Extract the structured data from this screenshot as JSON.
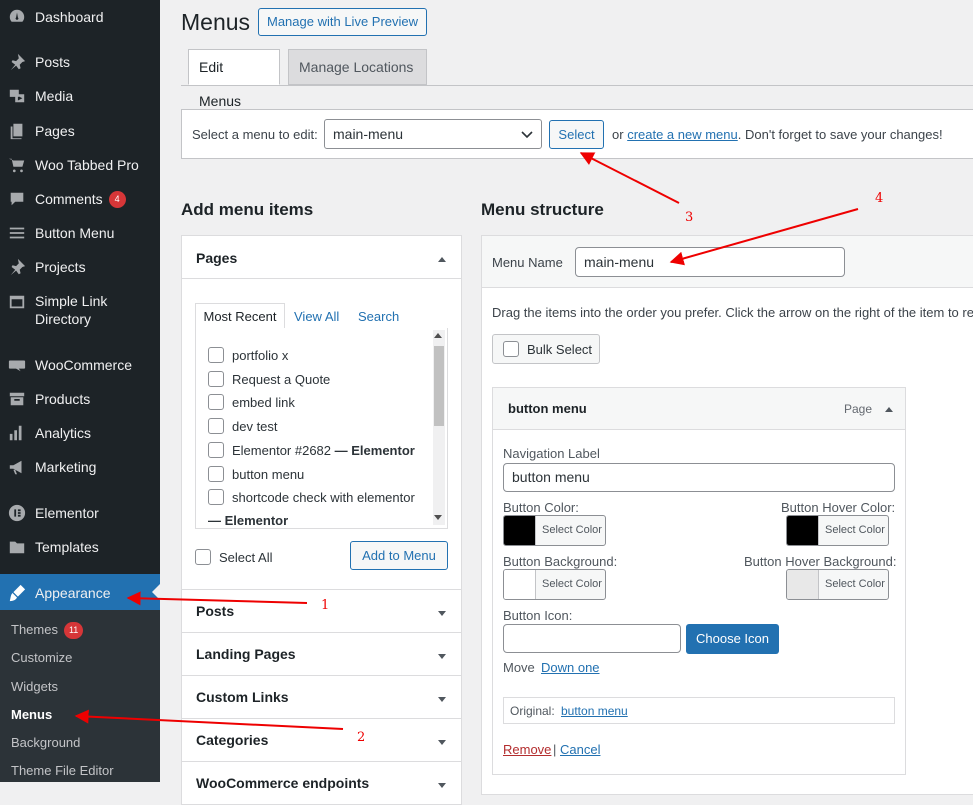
{
  "sidebar": {
    "items": [
      {
        "label": "Dashboard",
        "icon": "dashboard-icon"
      },
      {
        "label": "Posts",
        "icon": "pin-icon"
      },
      {
        "label": "Media",
        "icon": "media-icon"
      },
      {
        "label": "Pages",
        "icon": "pages-icon"
      },
      {
        "label": "Woo Tabbed Pro",
        "icon": "cart-icon"
      },
      {
        "label": "Comments",
        "icon": "comment-icon",
        "badge": "4"
      },
      {
        "label": "Button Menu",
        "icon": "menu-icon"
      },
      {
        "label": "Projects",
        "icon": "pin-icon"
      },
      {
        "label": "Simple Link",
        "label2": "Directory",
        "icon": "window-icon"
      },
      {
        "label": "WooCommerce",
        "icon": "woo-icon"
      },
      {
        "label": "Products",
        "icon": "archive-icon"
      },
      {
        "label": "Analytics",
        "icon": "bar-chart-icon"
      },
      {
        "label": "Marketing",
        "icon": "megaphone-icon"
      },
      {
        "label": "Elementor",
        "icon": "elementor-icon"
      },
      {
        "label": "Templates",
        "icon": "folder-icon"
      }
    ],
    "appearance": {
      "label": "Appearance",
      "icon": "brush-icon"
    },
    "submenu": [
      {
        "label": "Themes",
        "badge": "11"
      },
      {
        "label": "Customize"
      },
      {
        "label": "Widgets"
      },
      {
        "label": "Menus"
      },
      {
        "label": "Background"
      },
      {
        "label": "Theme File Editor"
      }
    ]
  },
  "header": {
    "title": "Menus",
    "live_preview": "Manage with Live Preview",
    "tabs": [
      "Edit Menus",
      "Manage Locations"
    ]
  },
  "select_bar": {
    "label": "Select a menu to edit:",
    "value": "main-menu",
    "button": "Select",
    "or": "or",
    "create_link": "create a new menu",
    "after": ". Don't forget to save your changes!"
  },
  "add_items": {
    "title": "Add menu items",
    "pages": {
      "title": "Pages",
      "tabs": [
        "Most Recent",
        "View All",
        "Search"
      ],
      "items": [
        "portfolio x",
        "Request a Quote",
        "embed link",
        "dev test",
        "Elementor #2682",
        "button menu",
        "shortcode check with elementor"
      ],
      "elementor_suffix": "— Elementor",
      "overflow_line": "— Elementor",
      "select_all": "Select All",
      "add_button": "Add to Menu"
    },
    "sections": [
      "Posts",
      "Landing Pages",
      "Custom Links",
      "Categories",
      "WooCommerce endpoints"
    ]
  },
  "structure": {
    "title": "Menu structure",
    "name_label": "Menu Name",
    "name_value": "main-menu",
    "hint": "Drag the items into the order you prefer. Click the arrow on the right of the item to reveal additional configuration options.",
    "bulk_select": "Bulk Select",
    "item": {
      "title": "button menu",
      "type": "Page",
      "nav_label": "Navigation Label",
      "nav_value": "button menu",
      "button_color": "Button Color:",
      "button_hover_color": "Button Hover Color:",
      "button_background": "Button Background:",
      "button_hover_background": "Button Hover Background:",
      "select_color": "Select Color",
      "button_icon": "Button Icon:",
      "choose_icon": "Choose Icon",
      "move": "Move",
      "down_one": "Down one",
      "original_label": "Original:",
      "original_link": "button menu",
      "remove": "Remove",
      "separator": "|",
      "cancel": "Cancel"
    }
  },
  "colors": {
    "swatch_black": "#000000",
    "swatch_white": "#ffffff",
    "swatch_light": "#e8e8e8",
    "accent": "#2271b1",
    "annotation": "#e00000"
  },
  "annotations": [
    "1",
    "2",
    "3",
    "4"
  ]
}
